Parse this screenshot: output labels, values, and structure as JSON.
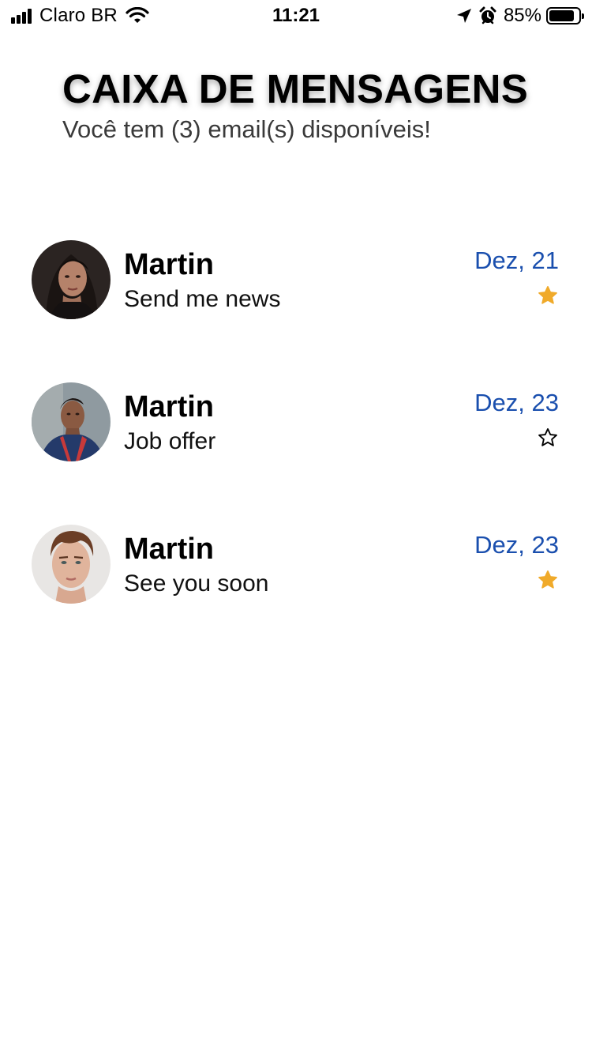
{
  "status_bar": {
    "carrier": "Claro BR",
    "time": "11:21",
    "battery_percent": "85%",
    "battery_level": 0.85,
    "icons": [
      "signal-icon",
      "wifi-icon",
      "location-arrow-icon",
      "alarm-icon",
      "battery-icon"
    ]
  },
  "header": {
    "title": "CAIXA DE MENSAGENS",
    "subtitle": "Você tem (3) email(s) disponíveis!"
  },
  "colors": {
    "date": "#1a4fae",
    "star_filled": "#f0aa2a",
    "star_outline": "#000000"
  },
  "messages": [
    {
      "sender": "Martin",
      "subject": "Send me news",
      "date": "Dez, 21",
      "starred": true,
      "avatar": "woman-portrait"
    },
    {
      "sender": "Martin",
      "subject": "Job offer",
      "date": "Dez, 23",
      "starred": false,
      "avatar": "man-hoodie-portrait"
    },
    {
      "sender": "Martin",
      "subject": "See you soon",
      "date": "Dez, 23",
      "starred": true,
      "avatar": "young-man-portrait"
    }
  ]
}
